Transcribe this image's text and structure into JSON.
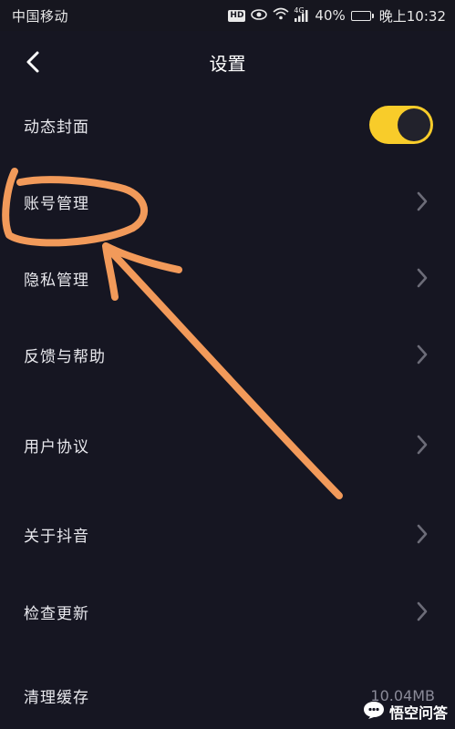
{
  "status_bar": {
    "carrier": "中国移动",
    "hd_badge": "HD",
    "network": "4G",
    "battery_percent": "40%",
    "battery_level": 0.4,
    "time": "晚上10:32"
  },
  "header": {
    "title": "设置"
  },
  "settings": {
    "dynamic_cover": {
      "label": "动态封面",
      "enabled": true
    },
    "account": {
      "label": "账号管理"
    },
    "privacy": {
      "label": "隐私管理"
    },
    "feedback": {
      "label": "反馈与帮助"
    },
    "agreement": {
      "label": "用户协议"
    },
    "about": {
      "label": "关于抖音"
    },
    "update": {
      "label": "检查更新"
    },
    "cache": {
      "label": "清理缓存",
      "value": "10.04MB"
    }
  },
  "colors": {
    "background": "#161622",
    "toggle_on": "#f8cc2a",
    "annotation": "#f29a5a"
  },
  "watermark": {
    "text": "悟空问答"
  }
}
